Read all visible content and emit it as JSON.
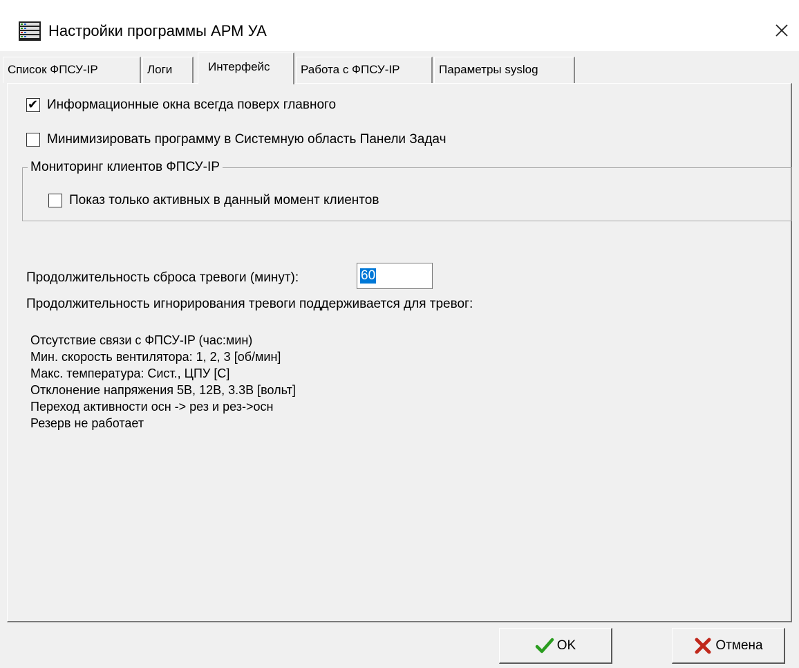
{
  "window": {
    "title": "Настройки программы АРМ УА",
    "app_icon": "server-rack-icon",
    "close_icon": "close-icon"
  },
  "tabs": [
    {
      "label": "Список ФПСУ-IP",
      "active": false
    },
    {
      "label": "Логи",
      "active": false
    },
    {
      "label": "Интерфейс",
      "active": true
    },
    {
      "label": "Работа с ФПСУ-IP",
      "active": false
    },
    {
      "label": "Параметры syslog",
      "active": false
    }
  ],
  "interface": {
    "info_windows_on_top": {
      "label": "Информационные окна  всегда поверх главного",
      "checked": true
    },
    "minimize_to_tray": {
      "label": "Минимизировать программу в Системную область Панели Задач",
      "checked": false
    },
    "monitoring_group": {
      "title": "Мониторинг клиентов ФПСУ-IP",
      "show_active_only": {
        "label": "Показ только активных в данный момент клиентов",
        "checked": false
      }
    },
    "alarm_reset": {
      "label": "Продолжительность сброса тревоги  (минут):",
      "value": "60"
    },
    "alarm_ignore_note": "Продолжительность игнорирования тревоги поддерживается для тревог:",
    "alarm_types": [
      "Отсутствие связи с ФПСУ-IP (час:мин)",
      "Мин. скорость вентилятора: 1, 2, 3 [об/мин]",
      "Макс. температура:  Сист., ЦПУ [С]",
      "Отклонение напряжения 5В, 12В, 3.3В [вольт]",
      "Переход активности осн -> рез и рез->осн",
      "Резерв не работает"
    ]
  },
  "buttons": {
    "ok": {
      "label": "OK",
      "icon": "checkmark-icon"
    },
    "cancel": {
      "label": "Отмена",
      "icon": "cross-icon"
    }
  },
  "colors": {
    "selection": "#0078d7",
    "ok_icon": "#2a9d1f",
    "cancel_icon": "#c0281c"
  }
}
